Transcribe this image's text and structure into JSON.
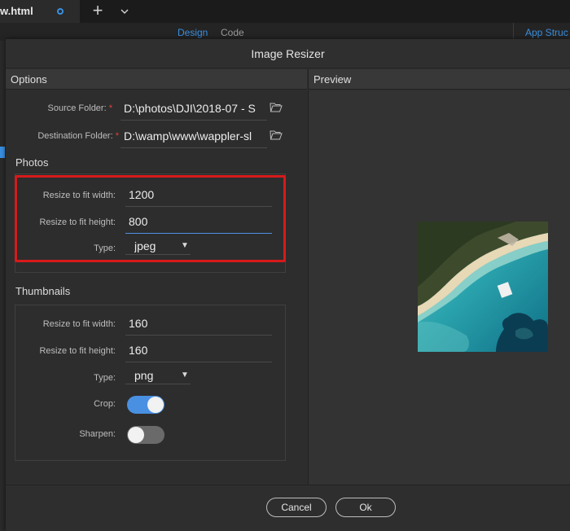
{
  "editor": {
    "tab_label": "w.html",
    "design_tab": "Design",
    "code_tab": "Code",
    "app_structure": "App Struc"
  },
  "dialog": {
    "title": "Image Resizer",
    "options_header": "Options",
    "preview_header": "Preview",
    "source_folder": {
      "label": "Source Folder:",
      "value": "D:\\photos\\DJI\\2018-07 - S"
    },
    "destination_folder": {
      "label": "Destination Folder:",
      "value": "D:\\wamp\\www\\wappler-sl"
    },
    "required_mark": "*",
    "photos": {
      "title": "Photos",
      "width_label": "Resize to fit width:",
      "width_value": "1200",
      "height_label": "Resize to fit height:",
      "height_value": "800",
      "type_label": "Type:",
      "type_value": "jpeg"
    },
    "thumbnails": {
      "title": "Thumbnails",
      "width_label": "Resize to fit width:",
      "width_value": "160",
      "height_label": "Resize to fit height:",
      "height_value": "160",
      "type_label": "Type:",
      "type_value": "png",
      "crop_label": "Crop:",
      "crop_on": true,
      "sharpen_label": "Sharpen:",
      "sharpen_on": false
    },
    "cancel_label": "Cancel",
    "ok_label": "Ok"
  },
  "colors": {
    "accent": "#3a8fe0",
    "toggle_on": "#4a90e2",
    "toggle_off": "#6a6a6a",
    "highlight_border": "#d71a1a",
    "required": "#e0443a"
  },
  "icons": {
    "plus": "plus-icon",
    "chevron": "chevron-down-icon",
    "folder": "folder-open-icon",
    "dropdown": "caret-down-icon"
  }
}
